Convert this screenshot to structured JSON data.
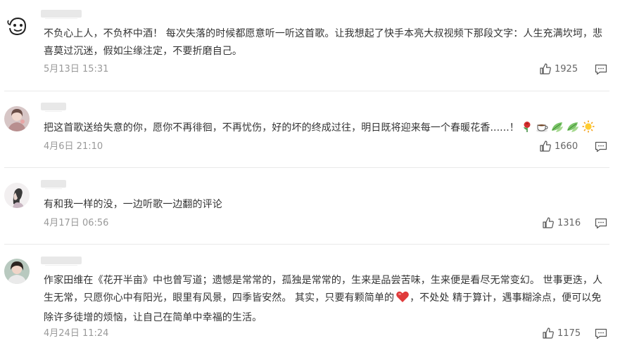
{
  "comments": [
    {
      "text": "不负心上人，不负杯中酒！ 每次失落的时候都愿意听一听这首歌。让我想起了快手本亮大叔视频下那段文字：人生充满坎坷，悲喜莫过沉迷，假如尘缘注定，不要折磨自己。",
      "date": "5月13日 15:31",
      "likes": "1925",
      "avatar_icon": "doodle-face-avatar"
    },
    {
      "text": "把这首歌送给失意的你，愿你不再徘徊，不再忧伤，好的坏的终成过往，明日既将迎来每一个春暖花香......！",
      "emojis": [
        "rose",
        "coffee",
        "leaves",
        "leaves",
        "sun"
      ],
      "date": "4月6日 21:10",
      "likes": "1660",
      "avatar_icon": "girl-photo-avatar"
    },
    {
      "text": "有和我一样的没，一边听歌一边翻的评论",
      "date": "4月17日 06:56",
      "likes": "1316",
      "avatar_icon": "profile-sketch-avatar"
    },
    {
      "text_before_heart": "作家田维在《花开半亩》中也曾写道；遗憾是常常的，孤独是常常的，生来是品尝苦味，生来便是看尽无常变幻。 世事更迭，人生无常，只愿你心中有阳光，眼里有风景，四季皆安然。 其实，只要有颗简单的",
      "heart_emoji": "heart",
      "text_after_heart": "，不处处 精于算计，遇事糊涂点，便可以免除许多徒增的烦恼，让自己在简单中幸福的生活。",
      "date": "4月24日 11:24",
      "likes": "1175",
      "avatar_icon": "portrait-photo-avatar"
    }
  ],
  "colors": {
    "text": "#333333",
    "date": "#999999",
    "count": "#666666",
    "divider": "#e9e9e9",
    "heart": "#e03b3b"
  }
}
